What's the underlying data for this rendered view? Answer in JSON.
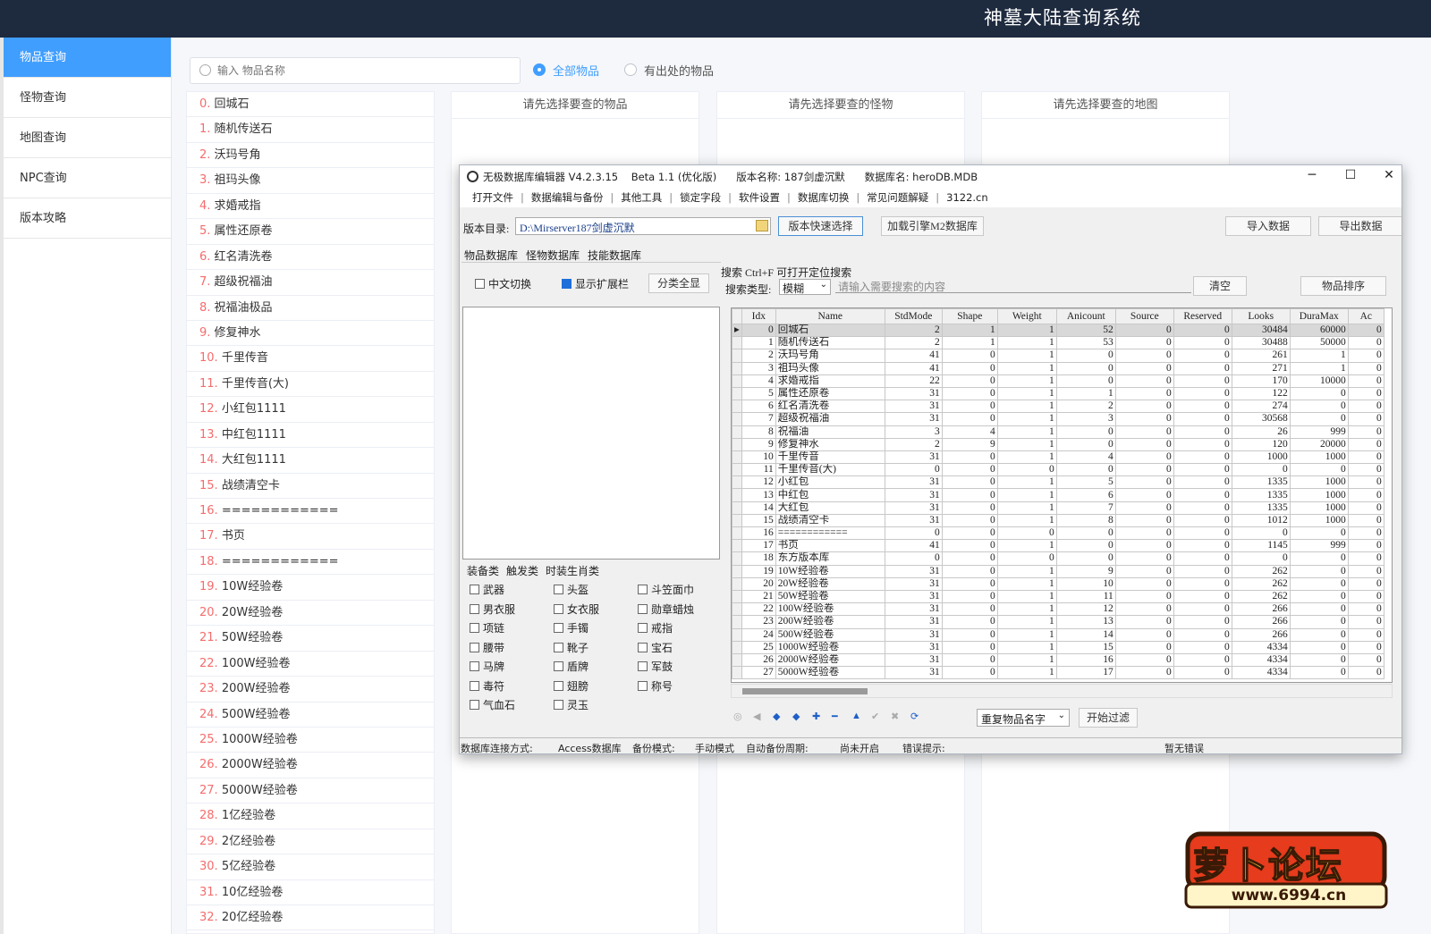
{
  "header": {
    "title": "神墓大陆查询系统"
  },
  "sidebar": {
    "items": [
      {
        "label": "物品查询",
        "active": true
      },
      {
        "label": "怪物查询"
      },
      {
        "label": "地图查询"
      },
      {
        "label": "NPC查询"
      },
      {
        "label": "版本攻略"
      }
    ]
  },
  "search": {
    "placeholder": "输入 物品名称",
    "value": ""
  },
  "filters": [
    {
      "label": "全部物品",
      "selected": true
    },
    {
      "label": "有出处的物品",
      "selected": false
    }
  ],
  "item_list": [
    {
      "num": "0.",
      "name": "回城石"
    },
    {
      "num": "1.",
      "name": "随机传送石"
    },
    {
      "num": "2.",
      "name": "沃玛号角"
    },
    {
      "num": "3.",
      "name": "祖玛头像"
    },
    {
      "num": "4.",
      "name": "求婚戒指"
    },
    {
      "num": "5.",
      "name": "属性还原卷"
    },
    {
      "num": "6.",
      "name": "红名清洗卷"
    },
    {
      "num": "7.",
      "name": "超级祝福油"
    },
    {
      "num": "8.",
      "name": "祝福油极品"
    },
    {
      "num": "9.",
      "name": "修复神水"
    },
    {
      "num": "10.",
      "name": "千里传音"
    },
    {
      "num": "11.",
      "name": "千里传音(大)"
    },
    {
      "num": "12.",
      "name": "小红包1111"
    },
    {
      "num": "13.",
      "name": "中红包1111"
    },
    {
      "num": "14.",
      "name": "大红包1111"
    },
    {
      "num": "15.",
      "name": "战绩清空卡"
    },
    {
      "num": "16.",
      "name": "============"
    },
    {
      "num": "17.",
      "name": "书页"
    },
    {
      "num": "18.",
      "name": "============"
    },
    {
      "num": "19.",
      "name": "10W经验卷"
    },
    {
      "num": "20.",
      "name": "20W经验卷"
    },
    {
      "num": "21.",
      "name": "50W经验卷"
    },
    {
      "num": "22.",
      "name": "100W经验卷"
    },
    {
      "num": "23.",
      "name": "200W经验卷"
    },
    {
      "num": "24.",
      "name": "500W经验卷"
    },
    {
      "num": "25.",
      "name": "1000W经验卷"
    },
    {
      "num": "26.",
      "name": "2000W经验卷"
    },
    {
      "num": "27.",
      "name": "5000W经验卷"
    },
    {
      "num": "28.",
      "name": "1亿经验卷"
    },
    {
      "num": "29.",
      "name": "2亿经验卷"
    },
    {
      "num": "30.",
      "name": "5亿经验卷"
    },
    {
      "num": "31.",
      "name": "10亿经验卷"
    },
    {
      "num": "32.",
      "name": "20亿经验卷"
    }
  ],
  "panels": {
    "item": "请先选择要查的物品",
    "monster": "请先选择要查的怪物",
    "map": "请先选择要查的地图"
  },
  "editor": {
    "title": "无极数据库编辑器 V4.2.3.15    Beta 1.1 (优化版)      版本名称: 187剑虚沉默      数据库名: heroDB.MDB",
    "window_buttons": {
      "min": "─",
      "max": "☐",
      "close": "✕"
    },
    "menu": [
      "打开文件",
      "数据编辑与备份",
      "其他工具",
      "锁定字段",
      "软件设置",
      "数据库切换",
      "常见问题解疑",
      "3122.cn"
    ],
    "dir_label": "版本目录:",
    "dir_value": "D:\\Mirserver187剑虚沉默",
    "quick_select": "版本快速选择",
    "load_m2": "加载引擎M2数据库",
    "import": "导入数据",
    "export": "导出数据",
    "db_tabs": [
      "物品数据库",
      "怪物数据库",
      "技能数据库"
    ],
    "chk_chinese": "中文切换",
    "chk_ext": "显示扩展栏",
    "btn_show_all": "分类全显",
    "search_title": "搜索  Ctrl+F 可打开定位搜索",
    "search_type_label": "搜索类型:",
    "search_type_value": "模糊",
    "search_placeholder": "请输入需要搜索的内容",
    "clear": "清空",
    "sort": "物品排序",
    "category_tabs": [
      "装备类",
      "触发类",
      "时装生肖类"
    ],
    "categories": [
      [
        "武器",
        "头盔",
        "斗笠面巾"
      ],
      [
        "男衣服",
        "女衣服",
        "勋章蜡烛"
      ],
      [
        "项链",
        "手镯",
        "戒指"
      ],
      [
        "腰带",
        "靴子",
        "宝石"
      ],
      [
        "马牌",
        "盾牌",
        "军鼓"
      ],
      [
        "毒符",
        "翅膀",
        "称号"
      ],
      [
        "气血石",
        "灵玉",
        ""
      ]
    ],
    "grid": {
      "columns": [
        "Idx",
        "Name",
        "StdMode",
        "Shape",
        "Weight",
        "Anicount",
        "Source",
        "Reserved",
        "Looks",
        "DuraMax",
        "Ac"
      ],
      "rows": [
        [
          "0",
          "回城石",
          "2",
          "1",
          "1",
          "52",
          "0",
          "0",
          "30484",
          "60000",
          "0"
        ],
        [
          "1",
          "随机传送石",
          "2",
          "1",
          "1",
          "53",
          "0",
          "0",
          "30488",
          "50000",
          "0"
        ],
        [
          "2",
          "沃玛号角",
          "41",
          "0",
          "1",
          "0",
          "0",
          "0",
          "261",
          "1",
          "0"
        ],
        [
          "3",
          "祖玛头像",
          "41",
          "0",
          "1",
          "0",
          "0",
          "0",
          "271",
          "1",
          "0"
        ],
        [
          "4",
          "求婚戒指",
          "22",
          "0",
          "1",
          "0",
          "0",
          "0",
          "170",
          "10000",
          "0"
        ],
        [
          "5",
          "属性还原卷",
          "31",
          "0",
          "1",
          "1",
          "0",
          "0",
          "122",
          "0",
          "0"
        ],
        [
          "6",
          "红名清洗卷",
          "31",
          "0",
          "1",
          "2",
          "0",
          "0",
          "274",
          "0",
          "0"
        ],
        [
          "7",
          "超级祝福油",
          "31",
          "0",
          "1",
          "3",
          "0",
          "0",
          "30568",
          "0",
          "0"
        ],
        [
          "8",
          "祝福油",
          "3",
          "4",
          "1",
          "0",
          "0",
          "0",
          "26",
          "999",
          "0"
        ],
        [
          "9",
          "修复神水",
          "2",
          "9",
          "1",
          "0",
          "0",
          "0",
          "120",
          "20000",
          "0"
        ],
        [
          "10",
          "千里传音",
          "31",
          "0",
          "1",
          "4",
          "0",
          "0",
          "1000",
          "1000",
          "0"
        ],
        [
          "11",
          "千里传音(大)",
          "0",
          "0",
          "0",
          "0",
          "0",
          "0",
          "0",
          "0",
          "0"
        ],
        [
          "12",
          "小红包",
          "31",
          "0",
          "1",
          "5",
          "0",
          "0",
          "1335",
          "1000",
          "0"
        ],
        [
          "13",
          "中红包",
          "31",
          "0",
          "1",
          "6",
          "0",
          "0",
          "1335",
          "1000",
          "0"
        ],
        [
          "14",
          "大红包",
          "31",
          "0",
          "1",
          "7",
          "0",
          "0",
          "1335",
          "1000",
          "0"
        ],
        [
          "15",
          "战绩清空卡",
          "31",
          "0",
          "1",
          "8",
          "0",
          "0",
          "1012",
          "1000",
          "0"
        ],
        [
          "16",
          "============",
          "0",
          "0",
          "0",
          "0",
          "0",
          "0",
          "0",
          "0",
          "0"
        ],
        [
          "17",
          "书页",
          "41",
          "0",
          "1",
          "0",
          "0",
          "0",
          "1145",
          "999",
          "0"
        ],
        [
          "18",
          "东方版本库",
          "0",
          "0",
          "0",
          "0",
          "0",
          "0",
          "0",
          "0",
          "0"
        ],
        [
          "19",
          "10W经验卷",
          "31",
          "0",
          "1",
          "9",
          "0",
          "0",
          "262",
          "0",
          "0"
        ],
        [
          "20",
          "20W经验卷",
          "31",
          "0",
          "1",
          "10",
          "0",
          "0",
          "262",
          "0",
          "0"
        ],
        [
          "21",
          "50W经验卷",
          "31",
          "0",
          "1",
          "11",
          "0",
          "0",
          "262",
          "0",
          "0"
        ],
        [
          "22",
          "100W经验卷",
          "31",
          "0",
          "1",
          "12",
          "0",
          "0",
          "266",
          "0",
          "0"
        ],
        [
          "23",
          "200W经验卷",
          "31",
          "0",
          "1",
          "13",
          "0",
          "0",
          "266",
          "0",
          "0"
        ],
        [
          "24",
          "500W经验卷",
          "31",
          "0",
          "1",
          "14",
          "0",
          "0",
          "266",
          "0",
          "0"
        ],
        [
          "25",
          "1000W经验卷",
          "31",
          "0",
          "1",
          "15",
          "0",
          "0",
          "4334",
          "0",
          "0"
        ],
        [
          "26",
          "2000W经验卷",
          "31",
          "0",
          "1",
          "16",
          "0",
          "0",
          "4334",
          "0",
          "0"
        ],
        [
          "27",
          "5000W经验卷",
          "31",
          "0",
          "1",
          "17",
          "0",
          "0",
          "4334",
          "0",
          "0"
        ]
      ]
    },
    "nav_icons": [
      "◎",
      "◀",
      "◆",
      "◆",
      "✚",
      "━",
      "▲",
      "✔",
      "✖",
      "⟳"
    ],
    "filter_select": "重复物品名字",
    "start_filter": "开始过滤",
    "status": {
      "conn_label": "数据库连接方式:",
      "conn_value": "Access数据库",
      "backup_label": "备份模式:",
      "backup_value": "手动模式",
      "cycle_label": "自动备份周期:",
      "cycle_value": "尚未开启",
      "error_label": "错误提示:",
      "error_value": "暂无错误"
    }
  },
  "watermark": {
    "logo_text": "萝卜论坛",
    "url": "www.6994.cn"
  }
}
